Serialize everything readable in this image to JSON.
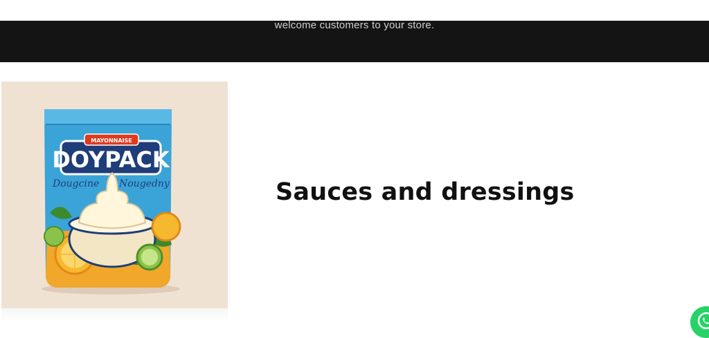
{
  "banner": {
    "text": "welcome customers to your store."
  },
  "product_image": {
    "badge": "MAYONNAISE",
    "brand": "DOYPACK",
    "script_left": "Dougcine",
    "script_right": "Nougedny"
  },
  "section": {
    "heading": "Sauces and dressings"
  },
  "colors": {
    "banner_bg": "#141414",
    "card_bg": "#f0e2d3",
    "pouch_blue": "#3aa3d8",
    "pouch_orange": "#f0a72a",
    "whatsapp": "#25d366"
  },
  "icons": {
    "chat": "whatsapp-icon"
  }
}
